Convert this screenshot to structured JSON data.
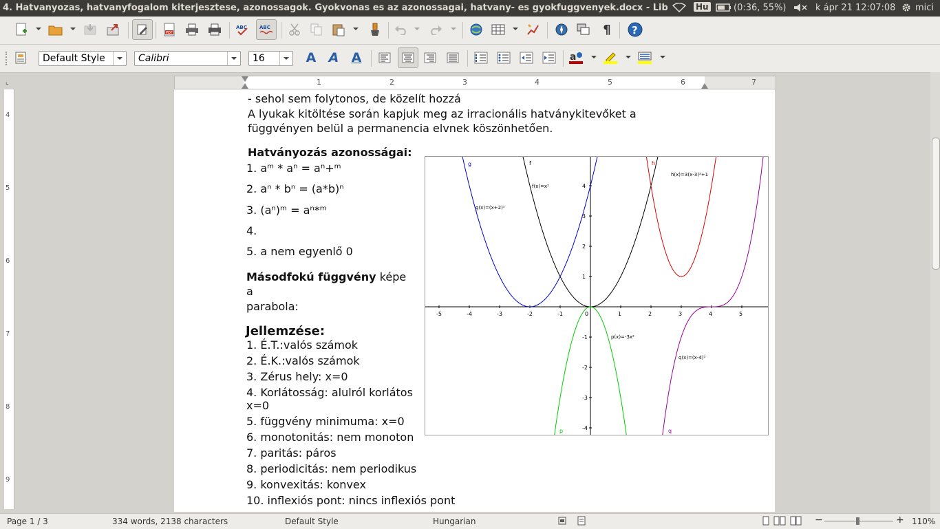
{
  "window_title": "4. Hatvanyozas, hatvanyfogalom kiterjesztese, azonossagok. Gyokvonas es az azonossagai, hatvany- es gyokfuggvenyek.docx - LibreOffice Writer",
  "system": {
    "keyboard": "Hu",
    "battery": "(0:36, 55%)",
    "clock": "k ápr 21 12:07:08",
    "user": "mici"
  },
  "toolbar": {
    "style_value": "Default Style",
    "font_value": "Calibri",
    "size_value": "16"
  },
  "ruler": {
    "h_numbers": [
      "1",
      "2",
      "3",
      "4",
      "5",
      "6",
      "7"
    ],
    "v_numbers": [
      "4",
      "5",
      "6",
      "7",
      "8",
      "9"
    ]
  },
  "document": {
    "lines": [
      "-    sehol sem folytonos, de közelít hozzá",
      "A lyukak kitöltése során kapjuk meg az irracionális hatványkitevőket a",
      "függvényen belül a permanencia elvnek köszönhetően."
    ],
    "identities_heading": "Hatványozás azonosságai:",
    "identities": [
      "1. aᵐ * aⁿ = aⁿ+ᵐ",
      "2. aⁿ * bⁿ = (a*b)ⁿ",
      "3. (aⁿ)ᵐ = aⁿ*ᵐ",
      "4.",
      "5. a nem egyenlő 0"
    ],
    "quadratic_bold": "Másodfokú függvény",
    "quadratic_rest": " képe",
    "quadratic_line2": "a",
    "quadratic_line3": "parabola:",
    "properties_heading": "Jellemzése:",
    "properties": [
      "1. É.T.:valós számok",
      "2. É.K.:valós számok",
      "3. Zérus hely: x=0",
      "4. Korlátosság: alulról korlátos",
      "x=0",
      "5. függvény minimuma: x=0",
      "6. monotonitás: nem monoton",
      "7. paritás: páros",
      "8. periodicitás: nem periodikus",
      "9. konvexitás: konvex",
      "10. inflexiós pont: nincs inflexiós pont"
    ]
  },
  "graph": {
    "x_ticks": [
      "-5",
      "-4",
      "-3",
      "-2",
      "-1",
      "0",
      "1",
      "2",
      "3",
      "4",
      "5"
    ],
    "y_ticks": [
      "4",
      "3",
      "2",
      "1",
      "-1",
      "-2",
      "-3",
      "-4"
    ],
    "labels": {
      "g": "g",
      "f": "f",
      "h": "h",
      "p": "p",
      "q": "q",
      "g_eq": "g(x)=(x+2)²",
      "f_eq": "f(x)=x²",
      "h_eq": "h(x)=3(x-3)²+1",
      "p_eq": "p(x)=-3x²",
      "q_eq": "q(x)=(x-4)³"
    },
    "colors": {
      "g": "#0000cc",
      "f": "#000000",
      "h": "#dd0000",
      "p": "#00cc00",
      "q": "#990099"
    }
  },
  "status": {
    "page": "Page 1 / 3",
    "words": "334 words, 2138 characters",
    "style": "Default Style",
    "language": "Hungarian",
    "zoom": "110%"
  }
}
